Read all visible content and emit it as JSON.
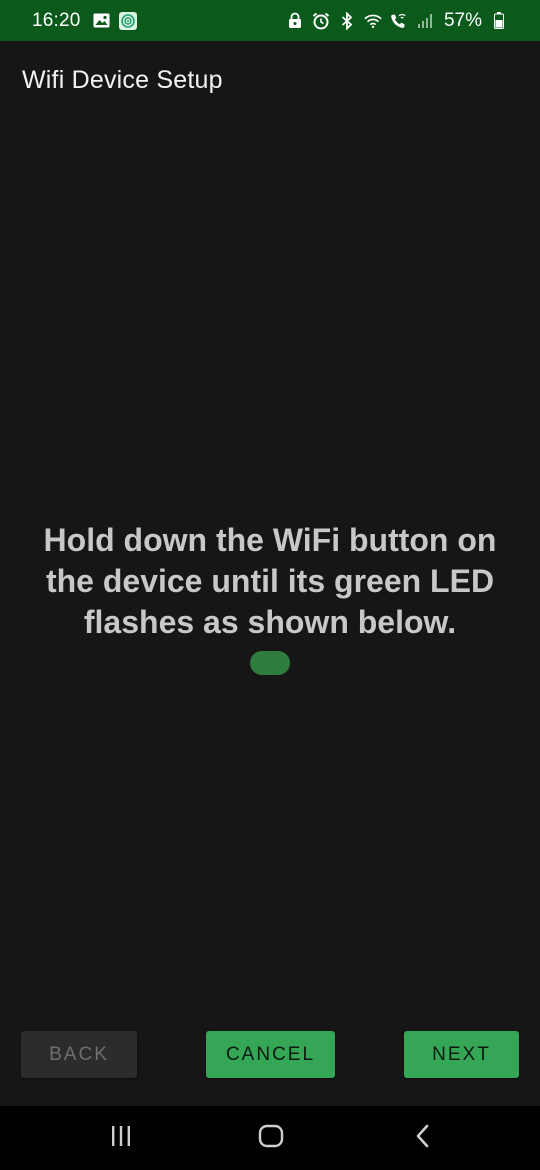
{
  "status_bar": {
    "time": "16:20",
    "battery_percent": "57%",
    "icons": [
      "gallery-icon",
      "app-notification-icon",
      "lock-icon",
      "alarm-icon",
      "bluetooth-icon",
      "wifi-icon",
      "wifi-calling-icon",
      "signal-icon",
      "battery-icon"
    ],
    "background_color": "#0b5a1c"
  },
  "app_bar": {
    "title": "Wifi Device Setup"
  },
  "main": {
    "instruction": "Hold down the WiFi button on the device until its green LED flashes as shown below.",
    "led_color": "#2e7d3f"
  },
  "buttons": {
    "back_label": "BACK",
    "cancel_label": "CANCEL",
    "next_label": "NEXT",
    "accent_color": "#35a556"
  },
  "nav_bar": {
    "icons": [
      "recents-icon",
      "home-icon",
      "back-arrow-icon"
    ]
  }
}
